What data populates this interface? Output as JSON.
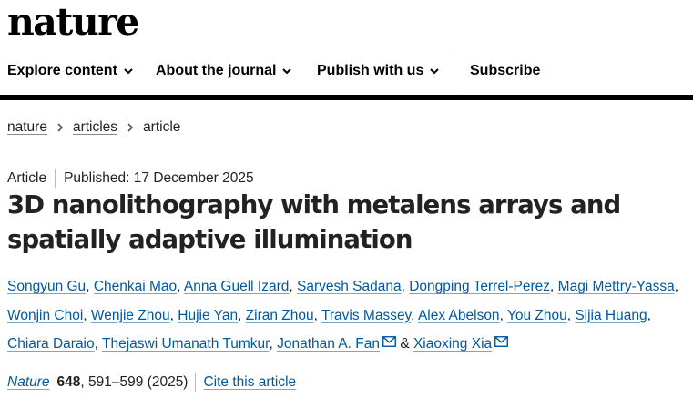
{
  "site": {
    "logo": "nature"
  },
  "nav": {
    "items": [
      {
        "label": "Explore content",
        "has_dropdown": true
      },
      {
        "label": "About the journal",
        "has_dropdown": true
      },
      {
        "label": "Publish with us",
        "has_dropdown": true
      },
      {
        "label": "Subscribe",
        "has_dropdown": false
      }
    ]
  },
  "breadcrumb": {
    "items": [
      "nature",
      "articles",
      "article"
    ]
  },
  "article": {
    "type": "Article",
    "published": "Published: 17 December 2025",
    "title": "3D nanolithography with metalens arrays and spatially adaptive illumination",
    "authors": [
      "Songyun Gu",
      "Chenkai Mao",
      "Anna Guell Izard",
      "Sarvesh Sadana",
      "Dongping Terrel-Perez",
      "Magi Mettry-Yassa",
      "Wonjin Choi",
      "Wenjie Zhou",
      "Hujie Yan",
      "Ziran Zhou",
      "Travis Massey",
      "Alex Abelson",
      "You Zhou",
      "Sijia Huang",
      "Chiara Daraio",
      "Thejaswi Umanath Tumkur",
      "Jonathan A. Fan",
      "Xiaoxing Xia"
    ],
    "author_separator": ",",
    "author_and": "&",
    "corresponding_icon": "mail-icon",
    "citation": {
      "journal": "Nature",
      "volume": "648",
      "pages_year": ", 591–599 (2025)",
      "cite_label": "Cite this article"
    }
  },
  "colors": {
    "link": "#00589e",
    "text": "#222222",
    "bar": "#000000"
  }
}
